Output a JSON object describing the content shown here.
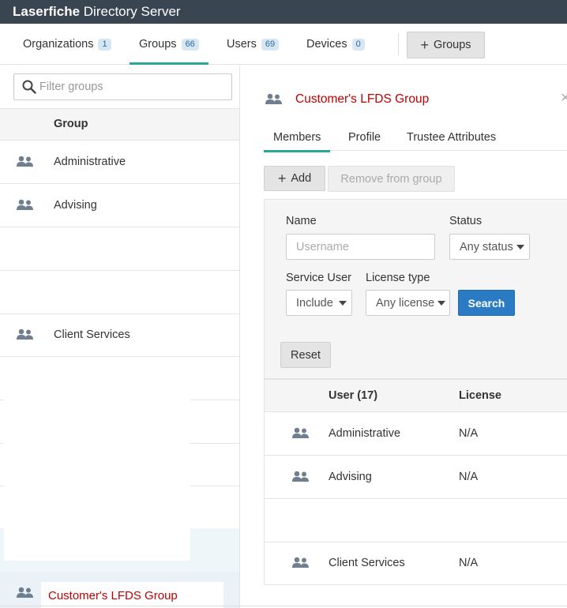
{
  "app": {
    "title_bold": "Laserfiche",
    "title_rest": " Directory Server"
  },
  "nav": {
    "tabs": [
      {
        "label": "Organizations",
        "count": "1"
      },
      {
        "label": "Groups",
        "count": "66"
      },
      {
        "label": "Users",
        "count": "69"
      },
      {
        "label": "Devices",
        "count": "0"
      }
    ],
    "add_groups_label": "Groups"
  },
  "left": {
    "filter_placeholder": "Filter groups",
    "column_header": "Group",
    "rows": [
      "Administrative",
      "Advising",
      "Client Services"
    ],
    "selected": "Customer's LFDS Group"
  },
  "detail": {
    "title": "Customer's LFDS Group",
    "close": "×",
    "tabs": [
      "Members",
      "Profile",
      "Trustee Attributes"
    ],
    "add_label": "Add",
    "remove_label": "Remove from group",
    "search": {
      "name_label": "Name",
      "name_placeholder": "Username",
      "status_label": "Status",
      "status_value": "Any status",
      "service_user_label": "Service User",
      "service_user_value": "Include",
      "license_type_label": "License type",
      "license_type_value": "Any license",
      "search_label": "Search",
      "reset_label": "Reset"
    },
    "results": {
      "user_header": "User (17)",
      "license_header": "License",
      "rows": [
        {
          "user": "Administrative",
          "license": "N/A"
        },
        {
          "user": "Advising",
          "license": "N/A"
        },
        {
          "user": "Client Services",
          "license": "N/A"
        }
      ]
    }
  },
  "colors": {
    "accent": "#2aa79b",
    "header_bg": "#3a4552",
    "primary": "#2b7bc4",
    "highlight_text": "#c00000"
  }
}
